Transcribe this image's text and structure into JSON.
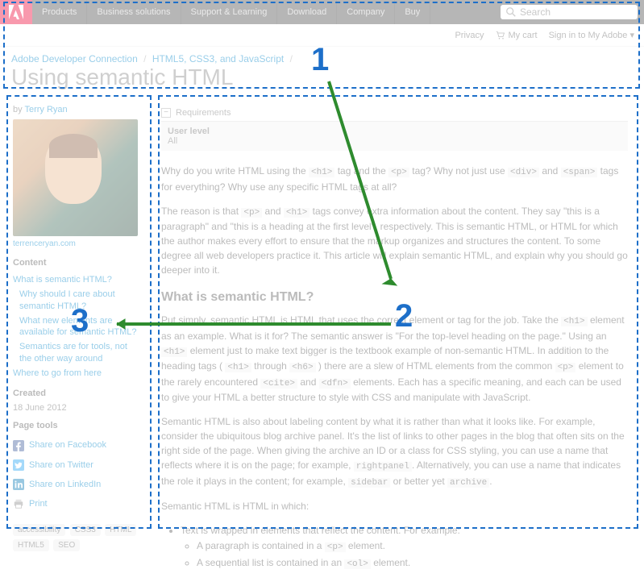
{
  "nav": {
    "items": [
      "Products",
      "Business solutions",
      "Support & Learning",
      "Download",
      "Company",
      "Buy"
    ],
    "search_placeholder": "Search"
  },
  "subnav": {
    "privacy": "Privacy",
    "cart": "My cart",
    "signin": "Sign in to My Adobe"
  },
  "breadcrumb": {
    "items": [
      "Adobe Developer Connection",
      "HTML5, CSS3, and JavaScript"
    ]
  },
  "page_title": "Using semantic HTML",
  "sidebar": {
    "by": "by",
    "author": "Terry Ryan",
    "author_site": "terrenceryan.com",
    "content_title": "Content",
    "toc": [
      "What is semantic HTML?",
      "Why should I care about semantic HTML?",
      "What new elements are available for semantic HTML?",
      "Semantics are for tools, not the other way around",
      "Where to go from here"
    ],
    "created_title": "Created",
    "created_date": "18 June 2012",
    "tools_title": "Page tools",
    "tools": [
      {
        "label": "Share on Facebook",
        "icon": "facebook"
      },
      {
        "label": "Share on Twitter",
        "icon": "twitter"
      },
      {
        "label": "Share on LinkedIn",
        "icon": "linkedin"
      },
      {
        "label": "Print",
        "icon": "print"
      }
    ],
    "tags": [
      "accessibility",
      "CSS3",
      "HTML",
      "HTML5",
      "SEO"
    ]
  },
  "article": {
    "requirements_label": "Requirements",
    "user_level_label": "User level",
    "user_level_value": "All",
    "p1a": "Why do you write HTML using the ",
    "p1b": " tag and the ",
    "p1c": " tag? Why not just use ",
    "p1d": " and ",
    "p1e": " tags for everything? Why use any specific HTML tags at all?",
    "p2a": "The reason is that ",
    "p2b": " and ",
    "p2c": " tags convey extra information about the content. They say \"this is a paragraph\" and \"this is a heading at the first level\", respectively. This is semantic HTML, or HTML for which the author makes every effort to ensure that the markup organizes and structures the content. To some degree all web developers practice it. This article will explain semantic HTML, and explain why you should go deeper into it.",
    "h2_1": "What is semantic HTML?",
    "p3a": "Put simply, semantic HTML is HTML that uses the correct element or tag for the job. Take the ",
    "p3b": " element as an example. What is it for? The semantic answer is \"For the top-level heading on the page.\" Using an ",
    "p3c": " element just to make text bigger is the textbook example of non-semantic HTML. In addition to the heading tags ( ",
    "p3d": " through ",
    "p3e": " ) there are a slew of HTML elements from the common ",
    "p3f": " element to the rarely encountered ",
    "p3g": " and ",
    "p3h": " elements. Each has a specific meaning, and each can be used to give your HTML a better structure to style with CSS and manipulate with JavaScript.",
    "p4a": "Semantic HTML is also about labeling content by what it is rather than what it looks like. For example, consider the ubiquitous blog archive panel. It's the list of links to other pages in the blog that often sits on the right side of the page. When giving the archive an ID or a class for CSS styling, you can use a name that reflects where it is on the page; for example, ",
    "p4b": ". Alternatively, you can use a name that indicates the role it plays in the content; for example, ",
    "p4c": " or better yet ",
    "p4d": ".",
    "p5": "Semantic HTML is HTML in which:",
    "li1": "Text is wrapped in elements that reflect the content. For example:",
    "li1a_a": "A paragraph is contained in a ",
    "li1a_b": " element.",
    "li1b_a": "A sequential list is contained in an ",
    "li1b_b": " element.",
    "codes": {
      "h1": "<h1>",
      "p": "<p>",
      "div": "<div>",
      "span": "<span>",
      "h6": "<h6>",
      "cite": "<cite>",
      "dfn": "<dfn>",
      "ol": "<ol>",
      "rightpanel": "rightpanel",
      "sidebar": "sidebar",
      "archive": "archive"
    }
  },
  "annotations": {
    "n1": "1",
    "n2": "2",
    "n3": "3"
  }
}
